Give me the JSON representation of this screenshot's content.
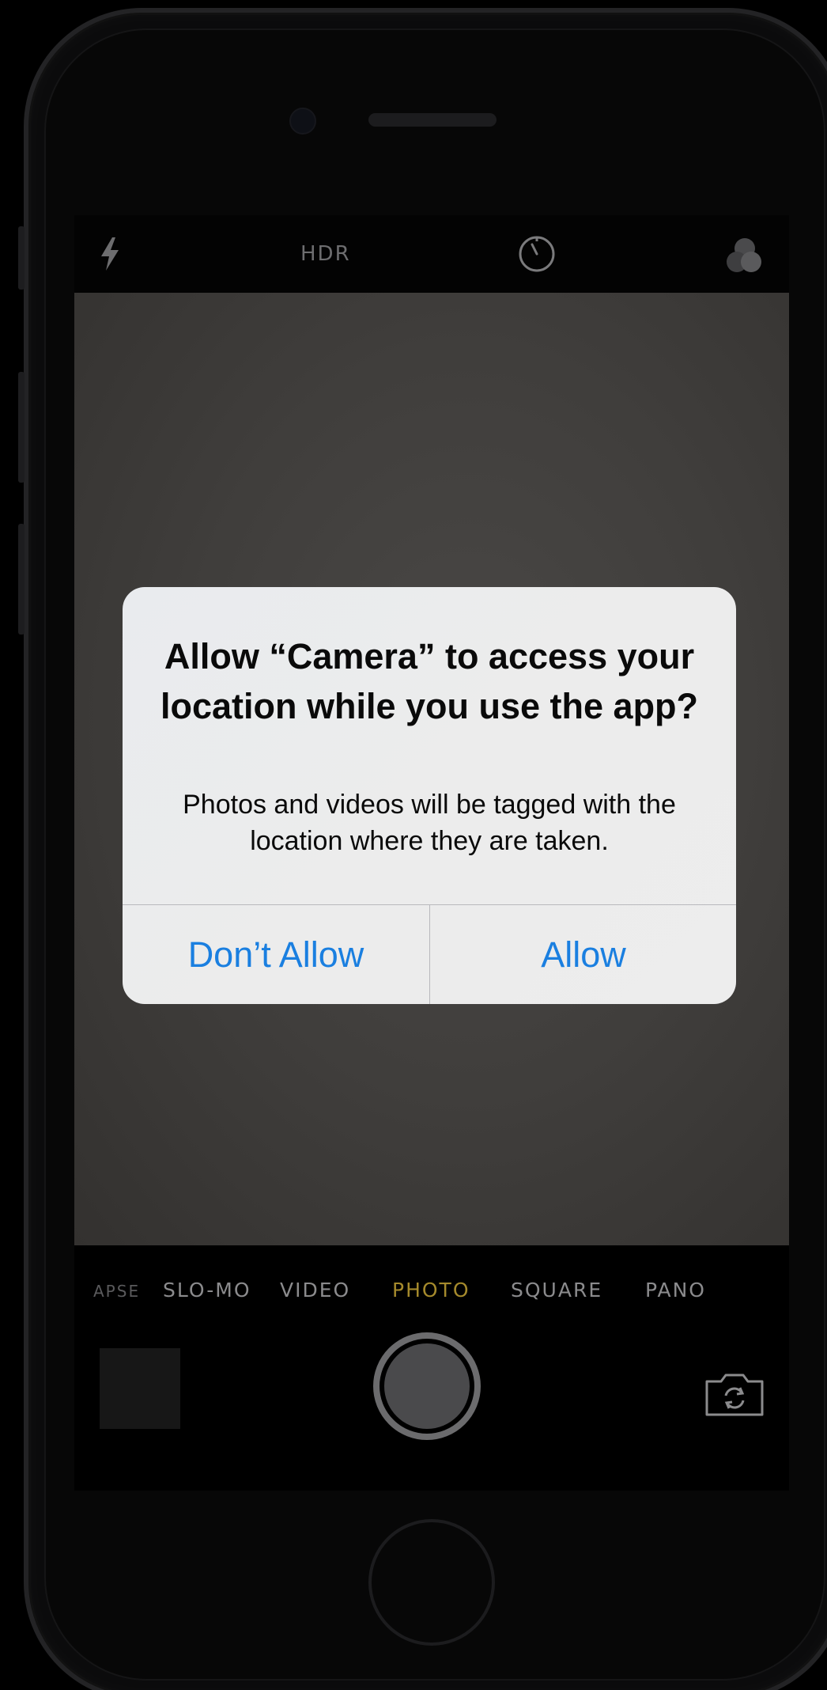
{
  "camera": {
    "top_bar": {
      "hdr_label": "HDR"
    },
    "modes": [
      {
        "label": "APSE",
        "state": "partial"
      },
      {
        "label": "SLO-MO",
        "state": "normal"
      },
      {
        "label": "VIDEO",
        "state": "normal"
      },
      {
        "label": "PHOTO",
        "state": "active"
      },
      {
        "label": "SQUARE",
        "state": "normal"
      },
      {
        "label": "PANO",
        "state": "normal"
      }
    ],
    "active_mode_color": "#a58a2c"
  },
  "alert": {
    "title": "Allow “Camera” to access your location while you use the app?",
    "message": "Photos and videos will be tagged with the location where they are taken.",
    "buttons": {
      "dont_allow": "Don’t Allow",
      "allow": "Allow"
    },
    "button_color": "#1a7fe0"
  },
  "icons": {
    "flash": "flash-icon",
    "timer": "timer-icon",
    "filters": "filters-icon",
    "flip": "camera-flip-icon"
  }
}
